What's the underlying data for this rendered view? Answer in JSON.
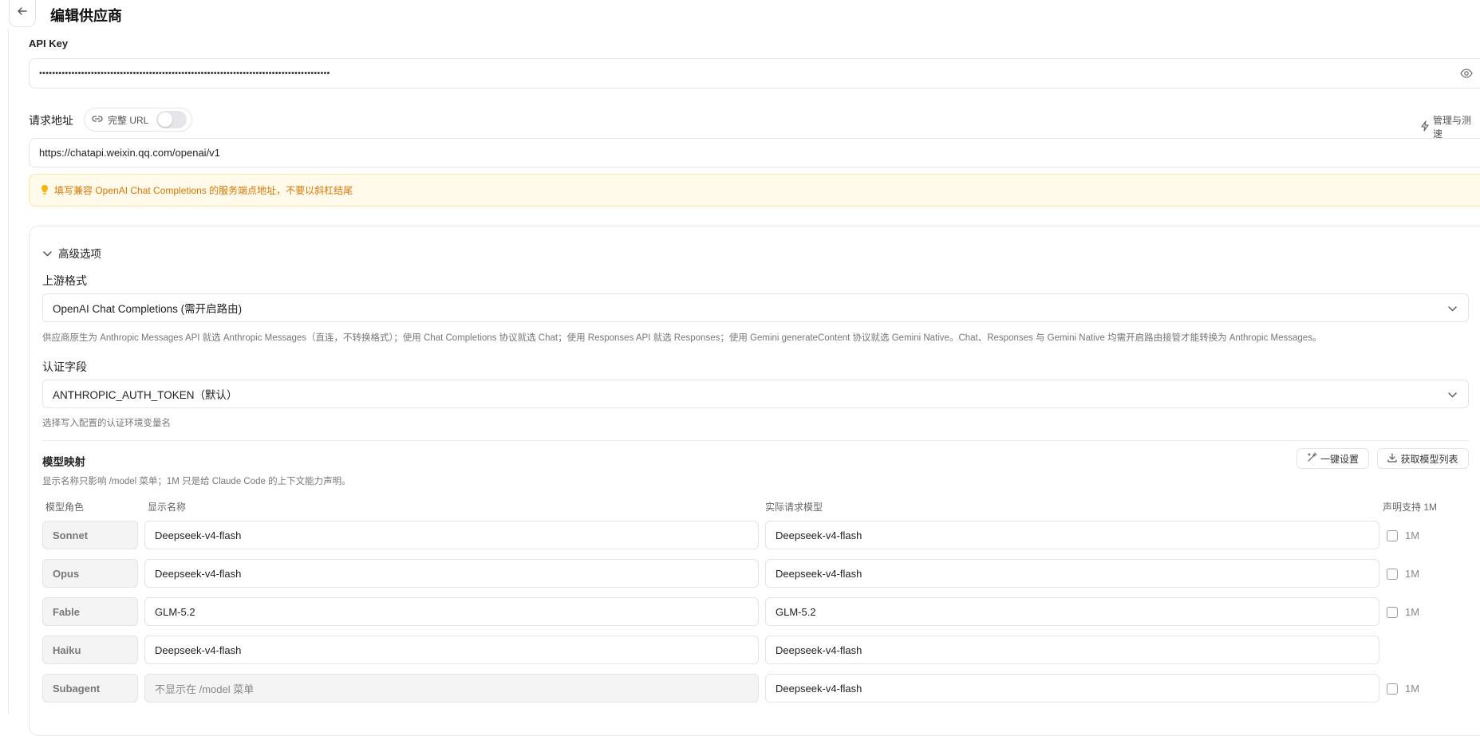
{
  "header": {
    "title": "编辑供应商",
    "back_icon": "arrow-left-icon"
  },
  "api_key": {
    "label": "API Key",
    "value": "••••••••••••••••••••••••••••••••••••••••••••••••••••••••••••••••••••••••••••••••••••••••••",
    "toggle_visibility_icon": "eye-icon"
  },
  "request_url": {
    "label": "请求地址",
    "full_url_label": "完整 URL",
    "full_url_enabled": false,
    "manage_label": "管理与测速",
    "value": "https://chatapi.weixin.qq.com/openai/v1",
    "hint": "填写兼容 OpenAI Chat Completions 的服务端点地址，不要以斜杠结尾"
  },
  "advanced": {
    "title": "高级选项",
    "upstream_format": {
      "label": "上游格式",
      "selected": "OpenAI Chat Completions (需开启路由)",
      "note": "供应商原生为 Anthropic Messages API 就选 Anthropic Messages（直连，不转换格式）；使用 Chat Completions 协议就选 Chat；使用 Responses API 就选 Responses；使用 Gemini generateContent 协议就选 Gemini Native。Chat、Responses 与 Gemini Native 均需开启路由接管才能转换为 Anthropic Messages。"
    },
    "auth_field": {
      "label": "认证字段",
      "selected": "ANTHROPIC_AUTH_TOKEN（默认）",
      "note": "选择写入配置的认证环境变量名"
    },
    "model_mapping": {
      "title": "模型映射",
      "note": "显示名称只影响 /model 菜单；1M 只是给 Claude Code 的上下文能力声明。",
      "one_click_label": "一键设置",
      "fetch_models_label": "获取模型列表",
      "columns": {
        "role": "模型角色",
        "display_name": "显示名称",
        "actual_model": "实际请求模型",
        "declare_1m": "声明支持 1M"
      },
      "rows": [
        {
          "role": "Sonnet",
          "display_name": "Deepseek-v4-flash",
          "display_placeholder": "",
          "actual_model": "Deepseek-v4-flash",
          "has_1m": true,
          "checked_1m": false,
          "label_1m": "1M"
        },
        {
          "role": "Opus",
          "display_name": "Deepseek-v4-flash",
          "display_placeholder": "",
          "actual_model": "Deepseek-v4-flash",
          "has_1m": true,
          "checked_1m": false,
          "label_1m": "1M"
        },
        {
          "role": "Fable",
          "display_name": "GLM-5.2",
          "display_placeholder": "",
          "actual_model": "GLM-5.2",
          "has_1m": true,
          "checked_1m": false,
          "label_1m": "1M"
        },
        {
          "role": "Haiku",
          "display_name": "Deepseek-v4-flash",
          "display_placeholder": "",
          "actual_model": "Deepseek-v4-flash",
          "has_1m": false,
          "checked_1m": false,
          "label_1m": ""
        },
        {
          "role": "Subagent",
          "display_name": "",
          "display_placeholder": "不显示在 /model 菜单",
          "actual_model": "Deepseek-v4-flash",
          "has_1m": true,
          "checked_1m": false,
          "label_1m": "1M"
        }
      ]
    }
  }
}
